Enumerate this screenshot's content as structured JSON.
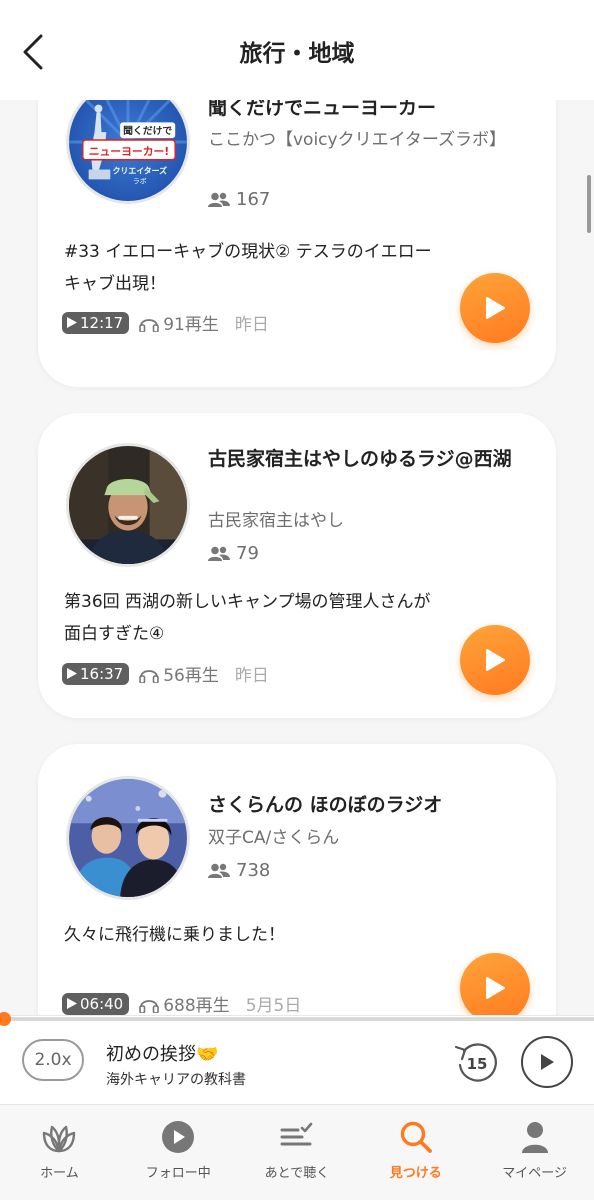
{
  "header": {
    "title": "旅行・地域"
  },
  "cards": [
    {
      "channel_title": "聞くだけでニューヨーカー",
      "author": "ここかつ【voicyクリエイターズラボ】",
      "followers": "167",
      "episode": "#33 イエローキャブの現状② テスラのイエローキャブ出現！",
      "duration": "12:17",
      "plays": "91再生",
      "date": "昨日",
      "avatar_text_1": "聞くだけで",
      "avatar_text_2": "ニューヨーカー!",
      "avatar_text_3": "クリエイターズ",
      "avatar_text_4": "ラボ"
    },
    {
      "channel_title": "古民家宿主はやしのゆるラジ@西湖",
      "author": "古民家宿主はやし",
      "followers": "79",
      "episode": "第36回 西湖の新しいキャンプ場の管理人さんが面白すぎた④",
      "duration": "16:37",
      "plays": "56再生",
      "date": "昨日"
    },
    {
      "channel_title": "さくらんの ほのぼのラジオ",
      "author": "双子CA/さくらん",
      "followers": "738",
      "episode": "久々に飛行機に乗りました！",
      "duration": "06:40",
      "plays": "688再生",
      "date": "5月5日"
    }
  ],
  "player": {
    "speed": "2.0x",
    "title": "初めの挨拶🤝",
    "subtitle": "海外キャリアの教科書",
    "rewind_seconds": "15",
    "progress": 0.01
  },
  "tabs": [
    {
      "label": "ホーム",
      "icon": "leaf-icon"
    },
    {
      "label": "フォロー中",
      "icon": "play-circle-icon"
    },
    {
      "label": "あとで聴く",
      "icon": "list-check-icon"
    },
    {
      "label": "見つける",
      "icon": "search-icon",
      "active": true
    },
    {
      "label": "マイページ",
      "icon": "person-icon"
    }
  ],
  "colors": {
    "accent": "#ff7a1e",
    "background": "#f6f6f6"
  }
}
